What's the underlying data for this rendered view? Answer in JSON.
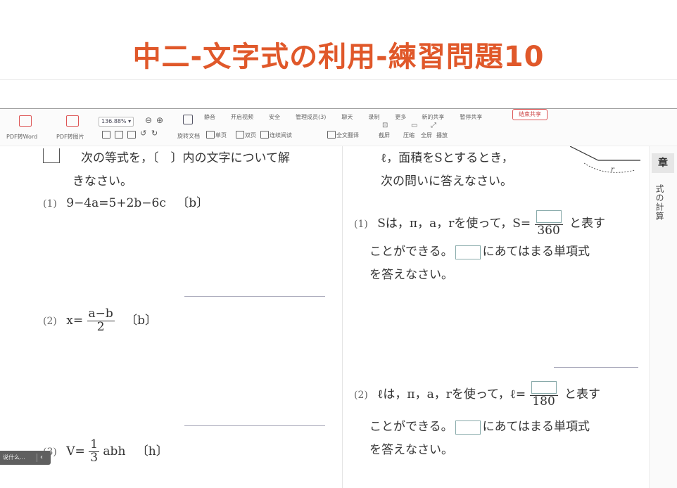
{
  "title": "中二-文字式の利用-練習問題10",
  "toolbar": {
    "top_labels": [
      "静音",
      "开启视频",
      "安全",
      "管理成员(3)",
      "聊天",
      "录制",
      "更多",
      "新的共享",
      "暂停共享"
    ],
    "share_button": "结束共享",
    "pdf_word": "PDF转Word",
    "pdf_image": "PDF转图片",
    "zoom": "136.88%",
    "rotate": "旋转文档",
    "single_page": "单页",
    "double_page": "双页",
    "continuous": "连续阅读",
    "translate": "全文翻译",
    "screenshot": "截屏",
    "compress": "压缩",
    "fullscreen": "全屏",
    "play": "播放"
  },
  "left": {
    "instruction_line1": "次の等式を，〔　〕内の文字について解",
    "instruction_line2": "きなさい。",
    "q1_num": "(1)",
    "q1_expr": "9−4a=5+2b−6c",
    "q1_bracket": "〔b〕",
    "q2_num": "(2)",
    "q2_lhs": "x=",
    "q2_frac_top": "a−b",
    "q2_frac_bot": "2",
    "q2_bracket": "〔b〕",
    "q3_num": "(3)",
    "q3_lhs": "V=",
    "q3_frac_top": "1",
    "q3_frac_bot": "3",
    "q3_rest": "abh",
    "q3_bracket": "〔h〕"
  },
  "right": {
    "intro_line1": "ℓ，面積をSとするとき，",
    "intro_line2": "次の問いに答えなさい。",
    "radius_label": "r",
    "q1_num": "(1)",
    "q1_text": "Sは，π，a，rを使って，S=",
    "q1_denominator": "360",
    "q1_tail": "と表す",
    "q1_line2_a": "ことができる。",
    "q1_line2_b": "にあてはまる単項式",
    "q1_line3": "を答えなさい。",
    "q2_num": "(2)",
    "q2_text": "ℓは，π，a，rを使って，ℓ=",
    "q2_denominator": "180",
    "q2_tail": "と表す",
    "q2_line2_a": "ことができる。",
    "q2_line2_b": "にあてはまる単項式",
    "q2_line3": "を答えなさい。"
  },
  "sidebar": {
    "chapter": "章",
    "vertical_text": "式の計算"
  },
  "chip": {
    "label": "说什么...",
    "arrow": "‹"
  }
}
